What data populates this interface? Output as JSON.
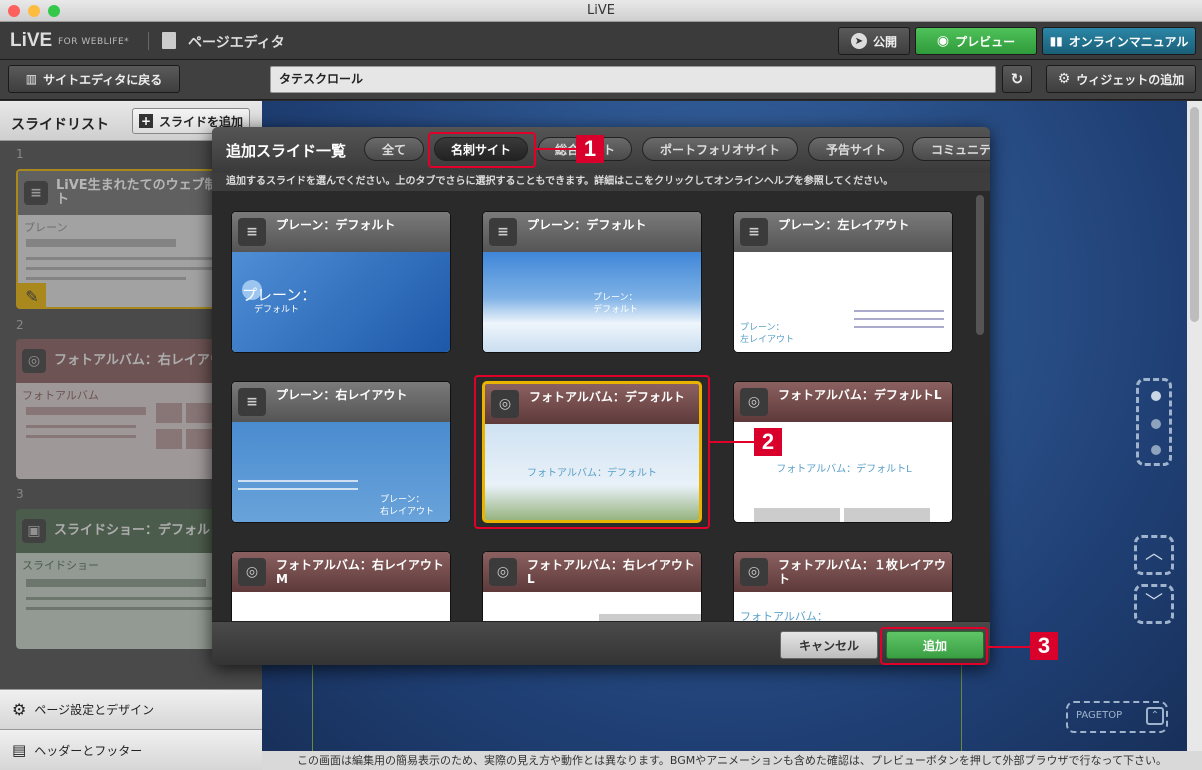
{
  "window": {
    "title": "LiVE"
  },
  "appbar": {
    "logo": "LiVE",
    "logo_sub": "FOR WEBLIFE*",
    "page_label": "ページエディタ",
    "publish_label": "公開",
    "preview_label": "プレビュー",
    "manual_label": "オンラインマニュアル"
  },
  "toolbar": {
    "back_label": "サイトエディタに戻る",
    "title_value": "タテスクロール",
    "widget_label": "ウィジェットの追加"
  },
  "sidebar": {
    "title": "スライドリスト",
    "add_label": "スライドを追加",
    "slides": [
      {
        "num": "1",
        "title": "LiVE生まれたてのウェブ制作ソフト",
        "sub": "プレーン"
      },
      {
        "num": "2",
        "title": "フォトアルバム：右レイアウトM",
        "sub": "フォトアルバム"
      },
      {
        "num": "3",
        "title": "スライドショー：デフォルト",
        "sub": "スライドショー"
      }
    ],
    "page_settings": "ページ設定とデザイン",
    "header_footer": "ヘッダーとフッター"
  },
  "modal": {
    "title": "追加スライド一覧",
    "tabs": [
      "全て",
      "名刺サイト",
      "総合サイト",
      "ポートフォリオサイト",
      "予告サイト",
      "コミュニティ"
    ],
    "hint": "追加するスライドを選んでください。上のタブでさらに選択することもできます。詳細はここをクリックしてオンラインヘルプを参照してください。",
    "cards": [
      {
        "title": "プレーン：デフォルト",
        "preview": "プレーン：",
        "preview2": "デフォルト"
      },
      {
        "title": "プレーン：デフォルト",
        "preview": "プレーン：",
        "preview2": "デフォルト"
      },
      {
        "title": "プレーン：左レイアウト",
        "preview": "プレーン：",
        "preview2": "左レイアウト"
      },
      {
        "title": "プレーン：右レイアウト",
        "preview": "プレーン：",
        "preview2": "右レイアウト"
      },
      {
        "title": "フォトアルバム：デフォルト",
        "preview": "フォトアルバム：デフォルト"
      },
      {
        "title": "フォトアルバム：デフォルトL",
        "preview": "フォトアルバム：デフォルトL"
      },
      {
        "title": "フォトアルバム：右レイアウトM"
      },
      {
        "title": "フォトアルバム：右レイアウトL"
      },
      {
        "title": "フォトアルバム：１枚レイアウト",
        "preview": "フォトアルバム："
      }
    ],
    "cancel_label": "キャンセル",
    "add_label": "追加"
  },
  "annotations": [
    "1",
    "2",
    "3"
  ],
  "canvas": {
    "pagetop": "PAGETOP"
  },
  "status": "この画面は編集用の簡易表示のため、実際の見え方や動作とは異なります。BGMやアニメーションも含めた確認は、プレビューボタンを押して外部ブラウザで行なって下さい。",
  "colors": {
    "accent_green": "#3fae48",
    "manual_teal": "#1f6f8b",
    "selected_border": "#e8b400",
    "annotation_red": "#d9002b"
  }
}
